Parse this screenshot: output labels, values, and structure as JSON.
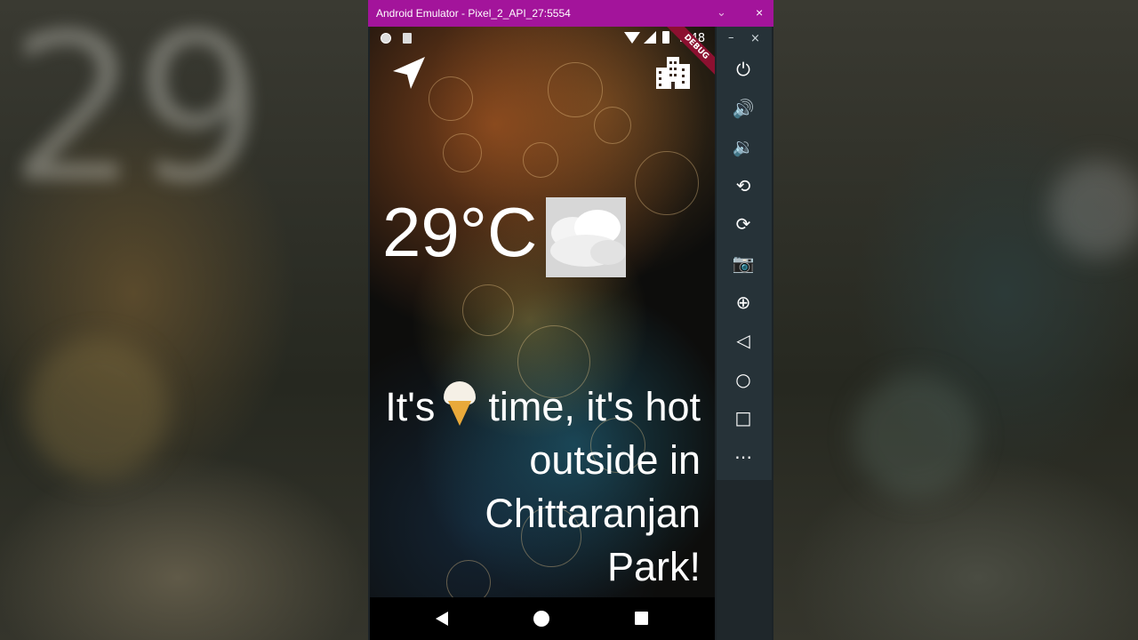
{
  "window": {
    "title": "Android Emulator - Pixel_2_API_27:5554"
  },
  "status_bar": {
    "time": "5:48",
    "debug_banner": "DEBUG"
  },
  "background": {
    "blurred_temp": "29"
  },
  "weather": {
    "temperature": "29°C",
    "condition_icon": "cloud-icon"
  },
  "message": {
    "before_icon": "It's",
    "icon": "ice-cream-icon",
    "after_icon": "time, it's hot outside in Chittaranjan Park!"
  },
  "top_icons": {
    "left": "navigation-arrow-icon",
    "right": "city-icon"
  },
  "emulator_controls": [
    {
      "name": "power-icon",
      "glyph": "⏻"
    },
    {
      "name": "volume-up-icon",
      "glyph": "🔊"
    },
    {
      "name": "volume-down-icon",
      "glyph": "🔉"
    },
    {
      "name": "rotate-left-icon",
      "glyph": "⟲"
    },
    {
      "name": "rotate-right-icon",
      "glyph": "⟳"
    },
    {
      "name": "camera-icon",
      "glyph": "📷"
    },
    {
      "name": "zoom-icon",
      "glyph": "⊕"
    },
    {
      "name": "back-icon",
      "glyph": "◁"
    },
    {
      "name": "home-icon",
      "glyph": "○"
    },
    {
      "name": "overview-icon",
      "glyph": "□"
    },
    {
      "name": "more-icon",
      "glyph": "⋯"
    }
  ],
  "colors": {
    "title_bar": "#a3149b",
    "sidebar": "#263238"
  }
}
